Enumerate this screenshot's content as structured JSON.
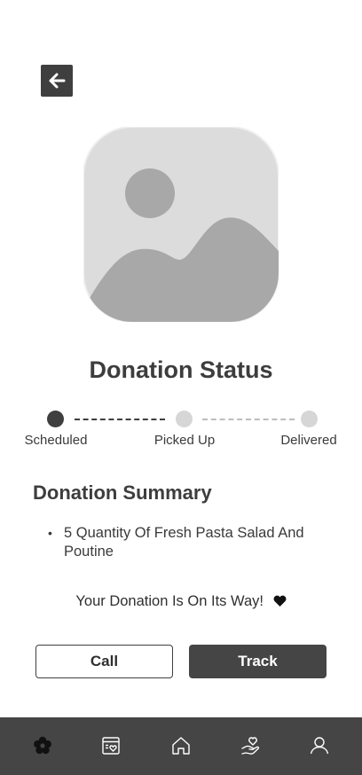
{
  "header": {
    "back_icon": "arrow-left-icon"
  },
  "hero": {
    "image_icon": "image-placeholder-icon"
  },
  "status": {
    "title": "Donation Status",
    "steps": [
      {
        "label": "Scheduled",
        "state": "complete"
      },
      {
        "label": "Picked Up",
        "state": "pending"
      },
      {
        "label": "Delivered",
        "state": "pending"
      }
    ]
  },
  "summary": {
    "heading": "Donation Summary",
    "items": [
      "5 Quantity Of Fresh Pasta Salad And Poutine"
    ],
    "bullet": "•"
  },
  "message": {
    "text": "Your Donation Is On Its Way!",
    "icon": "heart-icon"
  },
  "actions": {
    "call_label": "Call",
    "track_label": "Track"
  },
  "bottom_nav": {
    "items": [
      {
        "name": "flower",
        "icon": "flower-icon",
        "active": true
      },
      {
        "name": "donations",
        "icon": "box-heart-icon",
        "active": false
      },
      {
        "name": "home",
        "icon": "home-icon",
        "active": false
      },
      {
        "name": "giving",
        "icon": "hand-heart-icon",
        "active": false
      },
      {
        "name": "profile",
        "icon": "user-icon",
        "active": false
      }
    ]
  },
  "colors": {
    "dark": "#3f3f3f",
    "light_dot": "#d6d6d6",
    "nav_bg": "#454545"
  }
}
